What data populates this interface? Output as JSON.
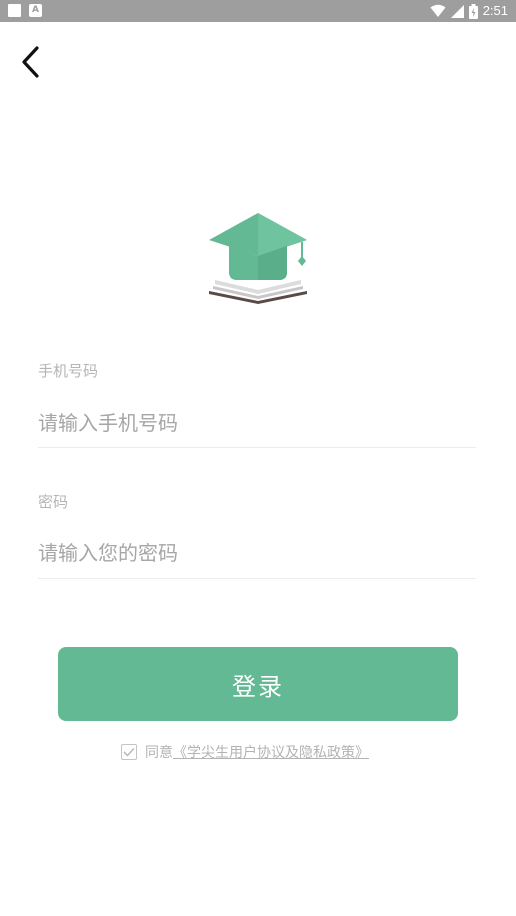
{
  "status_bar": {
    "time": "2:51",
    "icons": [
      "notification-square-icon",
      "a-icon",
      "wifi-icon",
      "cellular-icon",
      "battery-charging-icon"
    ]
  },
  "header": {
    "back_icon": "chevron-left-icon"
  },
  "logo": {
    "icon": "graduation-cap-book-icon",
    "colors": {
      "cap": "#63b994",
      "cap_dark": "#4e9f7c",
      "book_page": "#d9d9d9",
      "book_base": "#5a4a44"
    }
  },
  "form": {
    "phone": {
      "label": "手机号码",
      "placeholder": "请输入手机号码",
      "value": ""
    },
    "password": {
      "label": "密码",
      "placeholder": "请输入您的密码",
      "value": ""
    }
  },
  "login_button": {
    "label": "登录",
    "color": "#63b994"
  },
  "agreement": {
    "checked": true,
    "prefix": "同意",
    "link": "《学尖生用户协议及隐私政策》"
  }
}
